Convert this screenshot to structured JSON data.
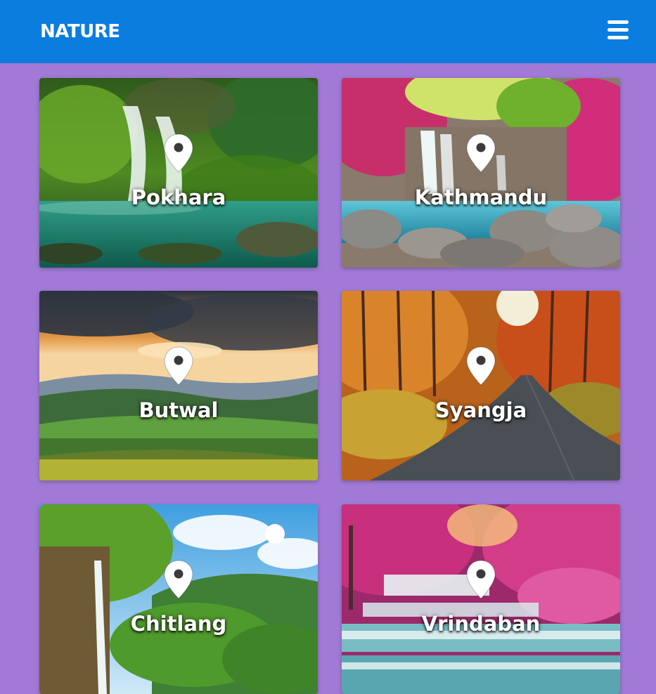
{
  "navbar": {
    "brand": "NATURE",
    "menu_icon": "hamburger-menu-icon",
    "background_color": "#0b7ddf"
  },
  "page": {
    "background_color": "#a07ad6"
  },
  "places": [
    {
      "name": "Pokhara",
      "icon": "location-pin-icon",
      "scene": "green waterfall and lake"
    },
    {
      "name": "Kathmandu",
      "icon": "location-pin-icon",
      "scene": "waterfall with pink trees and rocks"
    },
    {
      "name": "Butwal",
      "icon": "location-pin-icon",
      "scene": "sunset over green hills"
    },
    {
      "name": "Syangja",
      "icon": "location-pin-icon",
      "scene": "autumn forest road"
    },
    {
      "name": "Chitlang",
      "icon": "location-pin-icon",
      "scene": "waterfall cliff and blue sky"
    },
    {
      "name": "Vrindaban",
      "icon": "location-pin-icon",
      "scene": "pink trees and cascading waterfall"
    }
  ]
}
